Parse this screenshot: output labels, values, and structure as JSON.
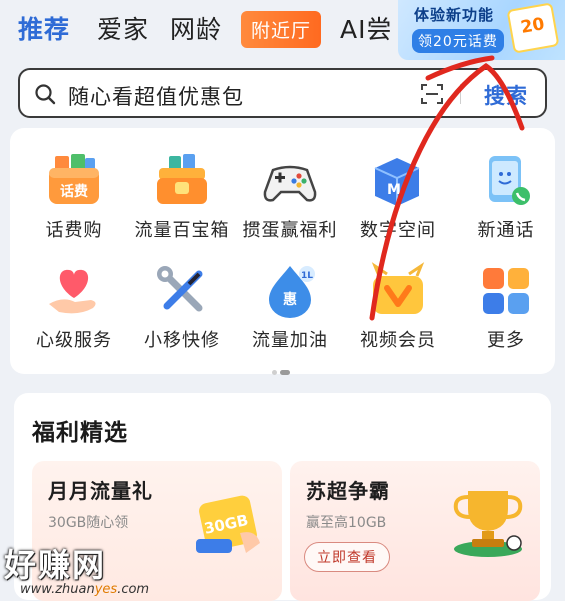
{
  "tabs": [
    {
      "label": "推荐",
      "active": true
    },
    {
      "label": "爱家",
      "active": false
    },
    {
      "label": "网龄",
      "active": false
    },
    {
      "label": "附近厅",
      "active": false
    },
    {
      "label": "AI尝",
      "active": false
    }
  ],
  "promo": {
    "line1": "体验新功能",
    "line2": "领20元话费",
    "card_text": "20"
  },
  "search": {
    "text": "随心看超值优惠包",
    "button": "搜索"
  },
  "services": [
    {
      "label": "话费购",
      "icon": "phone-bill-icon"
    },
    {
      "label": "流量百宝箱",
      "icon": "treasure-box-icon"
    },
    {
      "label": "掼蛋赢福利",
      "icon": "gamepad-icon"
    },
    {
      "label": "数字空间",
      "icon": "digital-space-icon"
    },
    {
      "label": "新通话",
      "icon": "new-call-icon"
    },
    {
      "label": "心级服务",
      "icon": "heart-hand-icon"
    },
    {
      "label": "小移快修",
      "icon": "wrench-screwdriver-icon"
    },
    {
      "label": "流量加油",
      "icon": "data-boost-icon"
    },
    {
      "label": "视频会员",
      "icon": "video-vip-icon"
    },
    {
      "label": "更多",
      "icon": "more-grid-icon"
    }
  ],
  "services_icon_text": {
    "phone_bill": "话费",
    "data_boost": "惠",
    "data_boost_badge": "1L"
  },
  "welfare": {
    "title": "福利精选",
    "cards": [
      {
        "title": "月月流量礼",
        "subtitle": "30GB随心领",
        "badge": "30GB"
      },
      {
        "title": "苏超争霸",
        "subtitle": "赢至高10GB",
        "button": "立即查看"
      }
    ]
  },
  "watermark": {
    "main": "好赚网",
    "sub_a": "www.zhuan",
    "sub_b": "yes",
    "sub_c": ".com"
  },
  "colors": {
    "accent": "#2f6bd6",
    "nearby_pill": "#ff7a2a",
    "annotation": "#e0281e"
  }
}
